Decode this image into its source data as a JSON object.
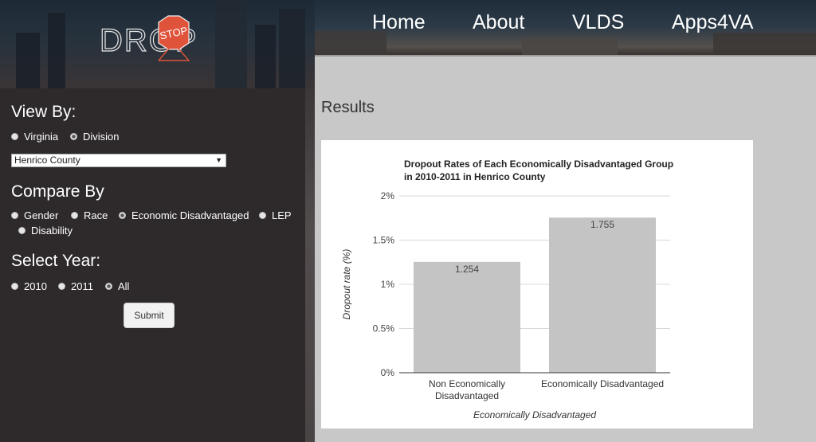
{
  "brand": {
    "logo_word": "DROP",
    "logo_sign": "STOP"
  },
  "nav": {
    "items": [
      "Home",
      "About",
      "VLDS",
      "Apps4VA"
    ]
  },
  "view_by": {
    "title": "View By:",
    "options": [
      "Virginia",
      "Division"
    ],
    "selected": "Division",
    "division_value": "Henrico County"
  },
  "compare_by": {
    "title": "Compare By",
    "options": [
      "Gender",
      "Race",
      "Economic Disadvantaged",
      "LEP",
      "Disability"
    ],
    "selected": "Economic Disadvantaged"
  },
  "select_year": {
    "title": "Select Year:",
    "options": [
      "2010",
      "2011",
      "All"
    ],
    "selected": "All"
  },
  "submit_label": "Submit",
  "results_title": "Results",
  "chart_data": {
    "type": "bar",
    "title": "Dropout Rates of Each Economically Disadvantaged Group in 2010-2011 in Henrico County",
    "title_lines": [
      "Dropout Rates of Each Economically Disadvantaged Group",
      "in 2010-2011 in Henrico County"
    ],
    "categories": [
      "Non Economically Disadvantaged",
      "Economically Disadvantaged"
    ],
    "category_lines": [
      [
        "Non Economically",
        "Disadvantaged"
      ],
      [
        "Economically Disadvantaged"
      ]
    ],
    "values": [
      1.254,
      1.755
    ],
    "value_labels": [
      "1.254",
      "1.755"
    ],
    "xlabel": "Economically Disadvantaged",
    "ylabel": "Dropout rate (%)",
    "ylim": [
      0,
      2
    ],
    "yticks": [
      0,
      0.5,
      1,
      1.5,
      2
    ],
    "ytick_labels": [
      "0%",
      "0.5%",
      "1%",
      "1.5%",
      "2%"
    ],
    "grid": true,
    "bar_color": "#c4c4c4"
  }
}
